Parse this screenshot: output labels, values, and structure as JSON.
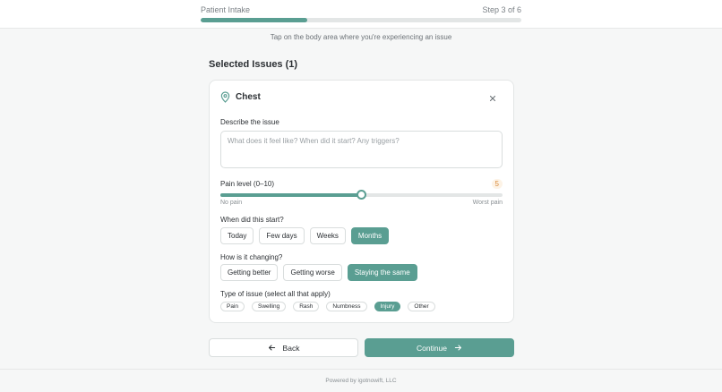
{
  "header": {
    "title": "Patient Intake",
    "step": "Step 3 of 6",
    "progress_fraction": 0.333
  },
  "hint": "Tap on the body area where you're experiencing an issue",
  "selected_title": "Selected Issues (1)",
  "issue": {
    "icon": "map-pin-icon",
    "name": "Chest",
    "describe_label": "Describe the issue",
    "describe_placeholder": "What does it feel like? When did it start? Any triggers?",
    "describe_value": "",
    "pain_label": "Pain level (0–10)",
    "pain_value": "5",
    "pain_level": 5,
    "pain_max": 10,
    "pain_min_label": "No pain",
    "pain_max_label": "Worst pain",
    "start_label": "When did this start?",
    "start_options": [
      {
        "label": "Today",
        "selected": false
      },
      {
        "label": "Few days",
        "selected": false
      },
      {
        "label": "Weeks",
        "selected": false
      },
      {
        "label": "Months",
        "selected": true
      }
    ],
    "change_label": "How is it changing?",
    "change_options": [
      {
        "label": "Getting better",
        "selected": false
      },
      {
        "label": "Getting worse",
        "selected": false
      },
      {
        "label": "Staying the same",
        "selected": true
      }
    ],
    "type_label": "Type of issue (select all that apply)",
    "type_options": [
      {
        "label": "Pain",
        "selected": false
      },
      {
        "label": "Swelling",
        "selected": false
      },
      {
        "label": "Rash",
        "selected": false
      },
      {
        "label": "Numbness",
        "selected": false
      },
      {
        "label": "Injury",
        "selected": true
      },
      {
        "label": "Other",
        "selected": false
      }
    ]
  },
  "buttons": {
    "back": "Back",
    "continue": "Continue"
  },
  "footer": "Powered by igotnowift, LLC",
  "colors": {
    "accent": "#5a9e92",
    "pain_badge": "#d98a3a"
  }
}
